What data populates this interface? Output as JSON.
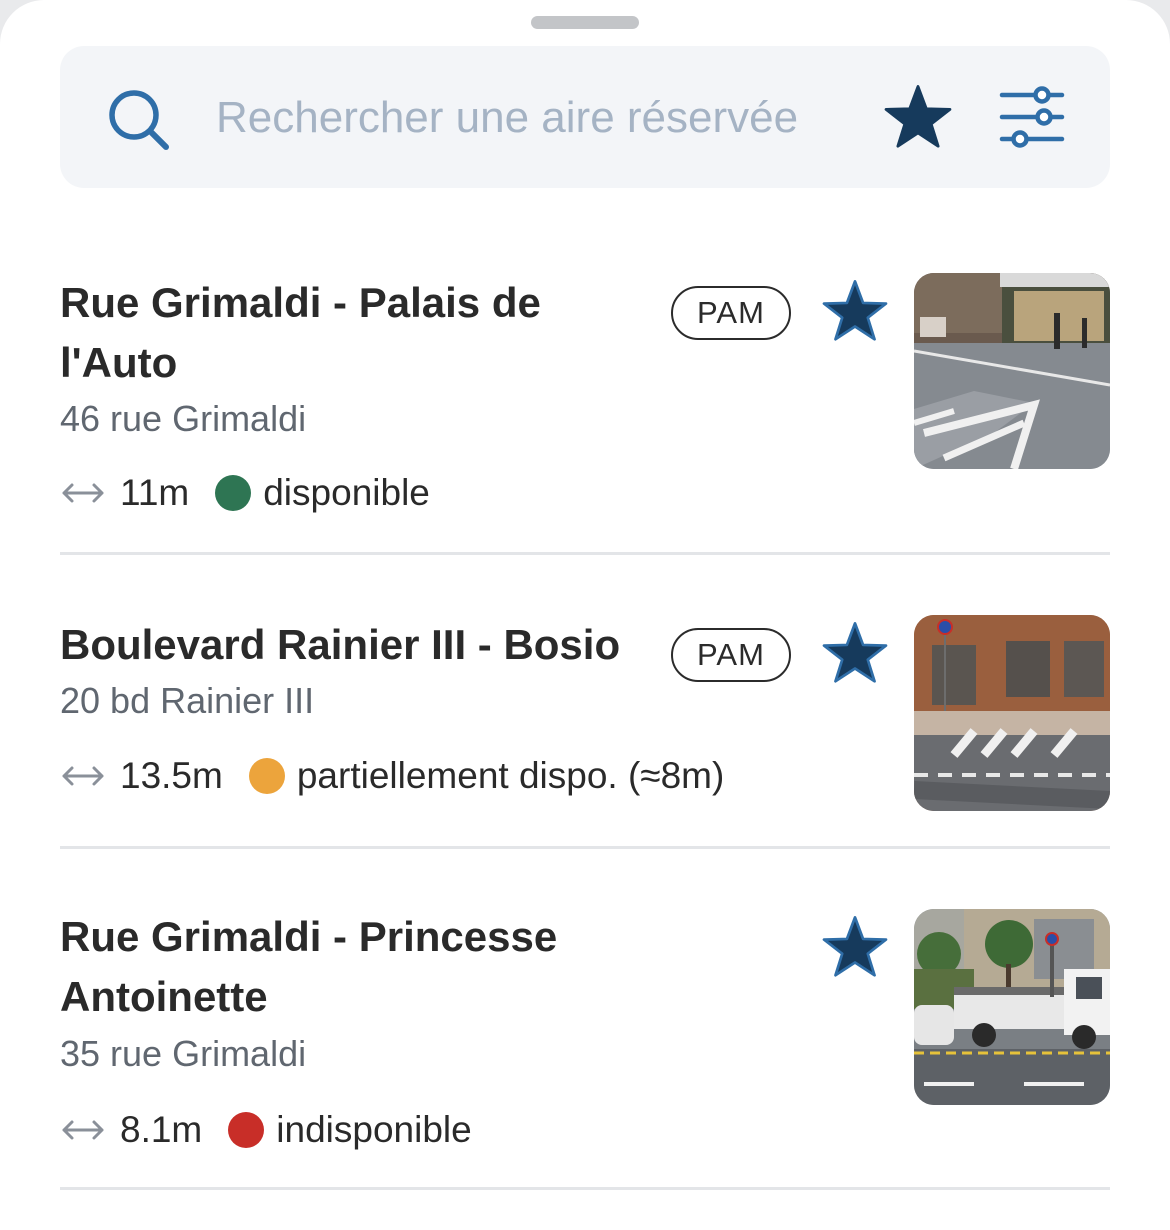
{
  "search": {
    "placeholder": "Rechercher une aire réservée",
    "value": ""
  },
  "icons": {
    "search": "search-icon",
    "favorites": "star-icon",
    "filters": "sliders-icon",
    "distance": "double-arrow-icon"
  },
  "colors": {
    "navy": "#163a5c",
    "search_blue": "#2f6ea8",
    "available": "#2e7553",
    "partial": "#eca43c",
    "unavailable": "#c82e28"
  },
  "spots": [
    {
      "title": "Rue Grimaldi - Palais de l'Auto",
      "address": "46 rue Grimaldi",
      "distance": "11m",
      "status": "disponible",
      "status_level": "available",
      "badge": "PAM",
      "favorite": true,
      "photo": "street-photo"
    },
    {
      "title": "Boulevard Rainier III - Bosio",
      "address": "20 bd Rainier III",
      "distance": "13.5m",
      "status": "partiellement dispo. (≈8m)",
      "status_level": "partial",
      "badge": "PAM",
      "favorite": true,
      "photo": "sidewalk-photo"
    },
    {
      "title": "Rue Grimaldi - Princesse Antoinette",
      "address": "35 rue Grimaldi",
      "distance": "8.1m",
      "status": "indisponible",
      "status_level": "unavailable",
      "badge": "",
      "favorite": true,
      "photo": "truck-photo"
    }
  ]
}
